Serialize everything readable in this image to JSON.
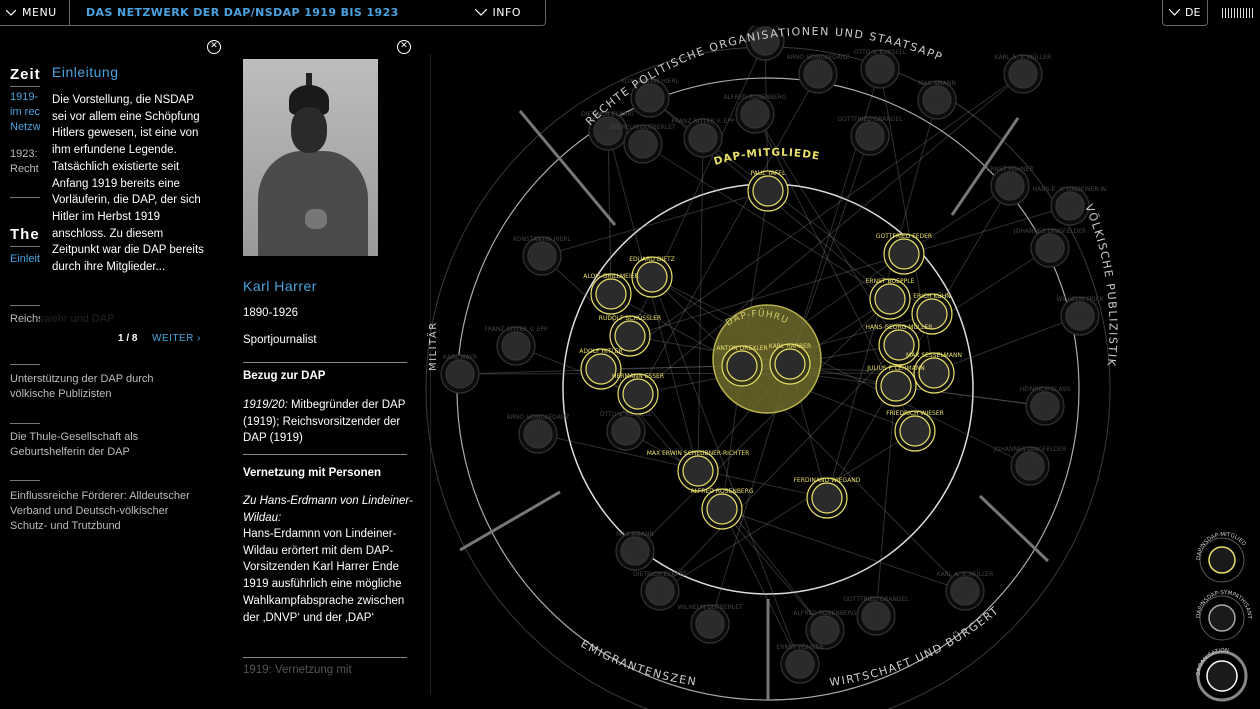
{
  "topbar": {
    "menu_label": "MENU",
    "title": "DAS NETZWERK DER DAP/NSDAP 1919 BIS 1923",
    "info_label": "INFO",
    "lang_label": "DE"
  },
  "sidebar": {
    "heading1": "Zeit",
    "blue_lines": [
      "1919-",
      "im rec",
      "Netzw"
    ],
    "text1": [
      "1923:",
      "Recht"
    ],
    "heading2": "The",
    "blue2": "Einleit",
    "item1": "Reichswehr und DAP",
    "item2": [
      "Unterstützung der DAP durch",
      "völkische Publizisten"
    ],
    "item3": [
      "Die Thule-Gesellschaft als",
      "Geburtshelferin der DAP"
    ],
    "item4": [
      "Einflussreiche Förderer: Alldeutscher",
      "Verband und Deutsch-völkischer",
      "Schutz- und Trutzbund"
    ]
  },
  "intro": {
    "title": "Einleitung",
    "text": "Die Vorstellung, die NSDAP sei vor allem eine Schöpfung Hitlers gewesen, ist eine von ihm erfundene Legende. Tatsächlich existierte seit Anfang 1919 bereits eine Vorläuferin, die DAP, der sich Hitler im Herbst 1919 anschloss. Zu diesem Zeitpunkt war die DAP bereits durch ihre Mitglieder...",
    "pager": "1 / 8",
    "next_label": "WEITER ›"
  },
  "person": {
    "name": "Karl Harrer",
    "years": "1890-1926",
    "profession": "Sportjournalist",
    "section1_title": "Bezug zur DAP",
    "section1_date": "1919/20:",
    "section1_text": "Mitbegründer der DAP (1919); Reichsvorsitzender der DAP (1919)",
    "section2_title": "Vernetzung mit Personen",
    "section2_sub": "Zu Hans-Erdmann von Lindeiner-Wildau:",
    "section2_text": "Hans-Erdamnn von Lindeiner-Wildau erörtert mit dem DAP-Vorsitzenden Karl Harrer Ende 1919 ausführlich eine mögliche Wahlkampfabsprache zwischen der ‚DNVP‘ und der ‚DAP‘",
    "faded": "1919: Vernetzung mit"
  },
  "network": {
    "ring_labels": {
      "top": "RECHTE POLITISCHE ORGANISATIONEN UND STAATSAPPARAT",
      "right": "VÖLKISCHE PUBLIZISTIK",
      "bottom_right": "WIRTSCHAFT UND BÜRGERTUM",
      "bottom_left": "EMIGRANTENSZENE",
      "left": "MILITÄR"
    },
    "inner_label": "DAP-MITGLIEDER",
    "center_label": "DAP-FÜHRUNG",
    "center_members": [
      "ANTON DREXLER",
      "KARL HARRER"
    ],
    "members": [
      "PAUL TAFEL",
      "EDUARD DIETZ",
      "ALOIS GRILLMEIER",
      "RUDOLF SCHÜSSLER",
      "ADOLF HITLER",
      "HERMANN ESSER",
      "GOTTFRIED FEDER",
      "ERNST BOEPPLE",
      "ERICH KÜHN",
      "HANS GEORG MÜLLER",
      "MAX SESSELMANN",
      "JULIUS F. LEHMANN",
      "FRIEDRICH WIESER",
      "MAX ERWIN SCHEUBNER-RICHTER",
      "ALFRED ROSENBERG",
      "FERDINAND WIEGAND"
    ],
    "outer_names": [
      "KONSTANTIN HIERL",
      "FRANZ RITTER V. EPP",
      "KARL MAYR",
      "ARNO SCHICKEDANZ",
      "OTTO V. KURSELL",
      "MAX AMANN",
      "DIETRICH ECKART",
      "WILHELM GUTBERLET",
      "ALFRED ROSENBERG",
      "GOTTFRIED GRANDEL",
      "KARL A. V. MÜLLER",
      "JOHANNES DINGFELDER",
      "ERNST PÖHNER",
      "WILHELM FRICK",
      "HEINRICH CLASS",
      "HANS-E. V. LINDEINER-W."
    ]
  },
  "legend": {
    "item1": "DAP/NSDAP-MITGLIED",
    "item2": "DAP/NSDAP-SYMPATHISANT",
    "item3": "ORGANISATION"
  },
  "colors": {
    "accent_blue": "#4aa3e0",
    "member_yellow": "#e8e06a"
  }
}
